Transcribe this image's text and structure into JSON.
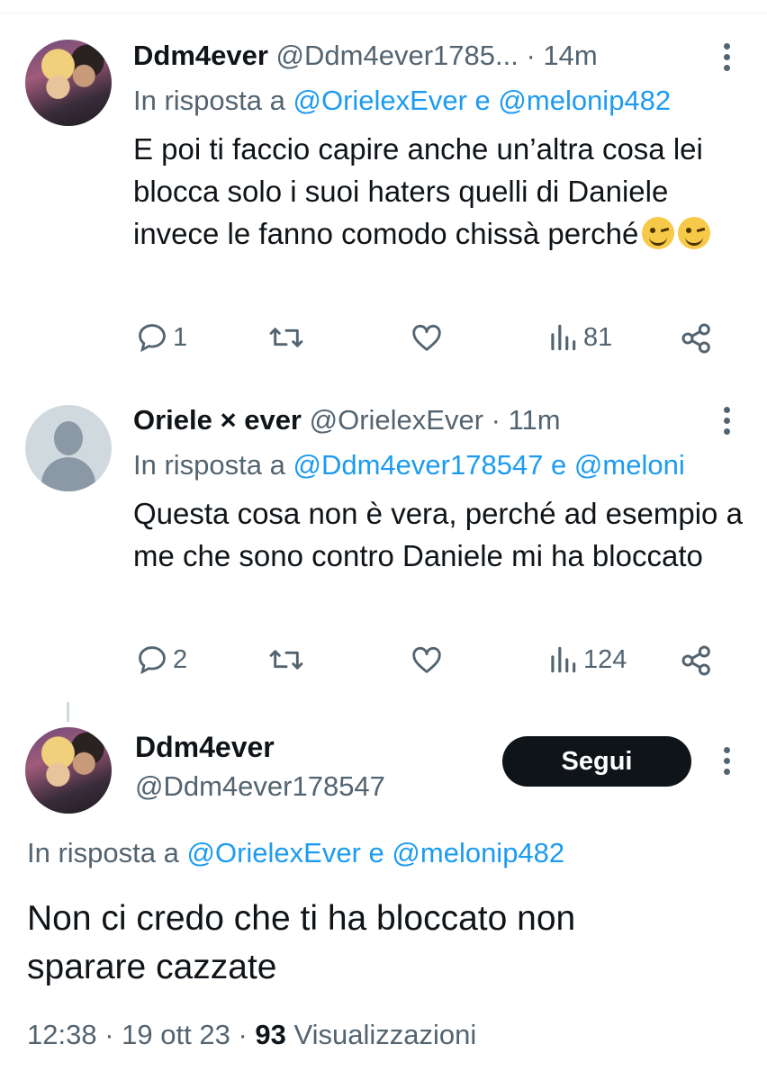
{
  "tweets": [
    {
      "name": "Ddm4ever",
      "handle": "@Ddm4ever1785...",
      "separator": "·",
      "time": "14m",
      "reply_prefix": "In risposta a",
      "reply_user1": "@OrielexEver",
      "reply_and": "e",
      "reply_user2": "@melonip482",
      "text": "E poi ti faccio capire anche un’altra cosa lei blocca solo i suoi haters quelli di Daniele invece le fanno comodo chissà perché",
      "emoji": [
        "winking-face",
        "winking-face"
      ],
      "replies": "1",
      "retweets": "",
      "likes": "",
      "views": "81"
    },
    {
      "name": "Oriele × ever",
      "handle": "@OrielexEver",
      "separator": "·",
      "time": "11m",
      "reply_prefix": "In risposta a",
      "reply_user1": "@Ddm4ever178547",
      "reply_and": "e",
      "reply_user2": "@meloni",
      "text": "Questa cosa non è vera, perché ad esempio a me che sono contro Daniele mi ha bloccato",
      "replies": "2",
      "retweets": "",
      "likes": "",
      "views": "124"
    }
  ],
  "main_tweet": {
    "name": "Ddm4ever",
    "handle": "@Ddm4ever178547",
    "follow_label": "Segui",
    "reply_prefix": "In risposta a",
    "reply_user1": "@OrielexEver",
    "reply_and": "e",
    "reply_user2": "@melonip482",
    "text": "Non ci credo che ti ha bloccato non sparare cazzate",
    "time": "12:38",
    "date": "19 ott 23",
    "separator": "·",
    "views_count": "93",
    "views_label": "Visualizzazioni"
  },
  "colors": {
    "link": "#1d9bf0",
    "muted": "#536471",
    "text": "#0f1419",
    "button": "#0f1419"
  },
  "icons": [
    "reply-icon",
    "retweet-icon",
    "like-icon",
    "views-icon",
    "share-icon",
    "more-icon"
  ]
}
